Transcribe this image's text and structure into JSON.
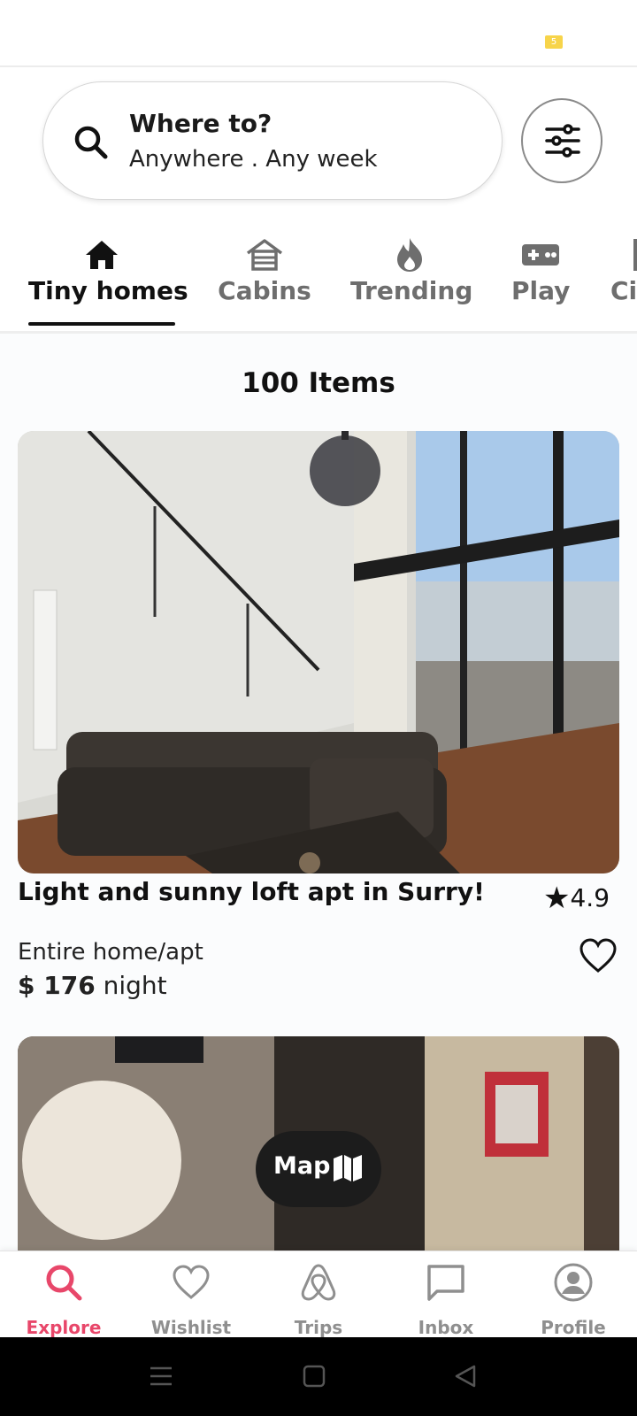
{
  "status_bar": {
    "indicator": "5"
  },
  "search": {
    "title": "Where to?",
    "subtitle": "Anywhere . Any week"
  },
  "categories": [
    {
      "label": "Tiny homes",
      "icon": "home-icon",
      "active": true
    },
    {
      "label": "Cabins",
      "icon": "cabin-icon",
      "active": false
    },
    {
      "label": "Trending",
      "icon": "fire-icon",
      "active": false
    },
    {
      "label": "Play",
      "icon": "gamepad-icon",
      "active": false
    },
    {
      "label": "Ci",
      "icon": "city-icon",
      "active": false
    }
  ],
  "results": {
    "count_label": "100 Items"
  },
  "listing": {
    "title": "Light and sunny loft apt in Surry!",
    "rating_star": "★",
    "rating": "4.9",
    "room_type": "Entire home/apt",
    "price": "$ 176",
    "price_unit": "night"
  },
  "map_button": {
    "label": "Map"
  },
  "bottom_nav": [
    {
      "label": "Explore",
      "icon": "search-icon",
      "active": true
    },
    {
      "label": "Wishlist",
      "icon": "heart-icon",
      "active": false
    },
    {
      "label": "Trips",
      "icon": "airbnb-icon",
      "active": false
    },
    {
      "label": "Inbox",
      "icon": "chat-icon",
      "active": false
    },
    {
      "label": "Profile",
      "icon": "profile-icon",
      "active": false
    }
  ],
  "colors": {
    "accent": "#e8476a",
    "inactive": "#8f8f8f",
    "text": "#111111"
  }
}
